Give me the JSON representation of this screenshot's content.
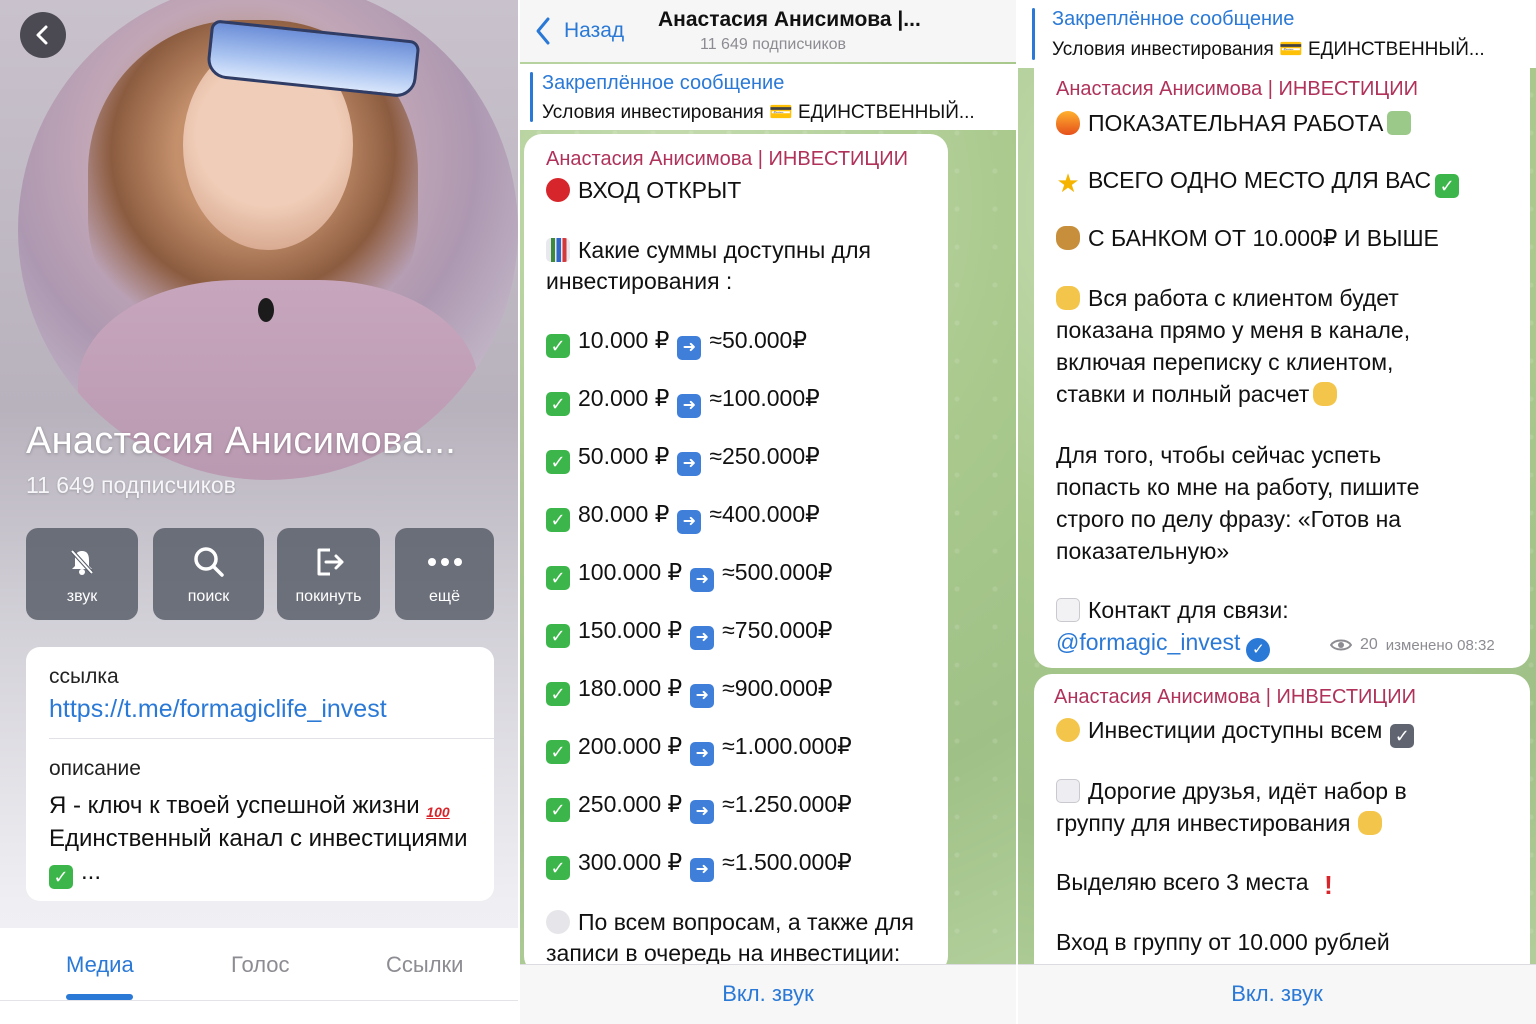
{
  "profile": {
    "name": "Анастасия Анисимова...",
    "subscribers": "11 649 подписчиков",
    "actions": [
      {
        "label": "звук",
        "icon": "bell-mute-icon"
      },
      {
        "label": "поиск",
        "icon": "search-icon"
      },
      {
        "label": "покинуть",
        "icon": "leave-icon"
      },
      {
        "label": "ещё",
        "icon": "more-dots-icon"
      }
    ],
    "link_label": "ссылка",
    "link": "https://t.me/formagiclife_invest",
    "desc_label": "описание",
    "desc_line1": "Я - ключ к твоей успешной жизни",
    "desc_line2": "Единственный канал с инвестициями",
    "desc_line3": "...",
    "tabs": [
      "Медиа",
      "Голос",
      "Ссылки"
    ]
  },
  "chat": {
    "back_label": "Назад",
    "title": "Анастасия Анисимова |...",
    "subscribers": "11 649 подписчиков",
    "pinned_title": "Закреплённое сообщение",
    "pinned_text": "Условия инвестирования 💳 ЕДИНСТВЕННЫЙ...",
    "author": "Анастасия Анисимова | ИНВЕСТИЦИИ",
    "msg1": {
      "head": "ВХОД ОТКРЫТ",
      "q1": "Какие суммы доступны для",
      "q2": "инвестирования :",
      "rows": [
        {
          "from": "10.000 ₽",
          "to": "≈50.000₽"
        },
        {
          "from": "20.000 ₽",
          "to": "≈100.000₽"
        },
        {
          "from": "50.000 ₽",
          "to": "≈250.000₽"
        },
        {
          "from": "80.000 ₽",
          "to": "≈400.000₽"
        },
        {
          "from": "100.000 ₽",
          "to": "≈500.000₽"
        },
        {
          "from": "150.000 ₽",
          "to": "≈750.000₽"
        },
        {
          "from": "180.000 ₽",
          "to": "≈900.000₽"
        },
        {
          "from": "200.000 ₽",
          "to": "≈1.000.000₽"
        },
        {
          "from": "250.000 ₽",
          "to": "≈1.250.000₽"
        },
        {
          "from": "300.000 ₽",
          "to": "≈1.500.000₽"
        }
      ],
      "tail1": "По всем вопросам, а также для",
      "tail2": "записи в очередь на инвестиции:"
    },
    "msg2": {
      "l1": "ПОКАЗАТЕЛЬНАЯ РАБОТА",
      "l2": "ВСЕГО ОДНО МЕСТО ДЛЯ ВАС",
      "l3": "С БАНКОМ ОТ 10.000₽ И ВЫШЕ",
      "p1": "Вся работа с клиентом будет",
      "p2": "показана прямо у меня в канале,",
      "p3": "включая переписку с клиентом,",
      "p4": "ставки и полный расчет",
      "q1": "Для того, чтобы сейчас успеть",
      "q2": "попасть ко мне на работу, пишите",
      "q3": "строго по делу фразу: «Готов на",
      "q4": "показательную»",
      "contact": "Контакт для связи:",
      "handle": "@formagic_invest",
      "views": "20",
      "edited": "изменено 08:32"
    },
    "msg3": {
      "l1": "Инвестиции доступны всем",
      "l2": "Дорогие друзья, идёт набор в",
      "l3": "группу для инвестирования",
      "l4": "Выделяю всего 3 места",
      "l5": "Вход в группу от 10.000 рублей"
    },
    "footer": "Вкл. звук"
  },
  "colors": {
    "accent": "#2a79d6",
    "author": "#b0325a",
    "check": "#3cb64a"
  }
}
